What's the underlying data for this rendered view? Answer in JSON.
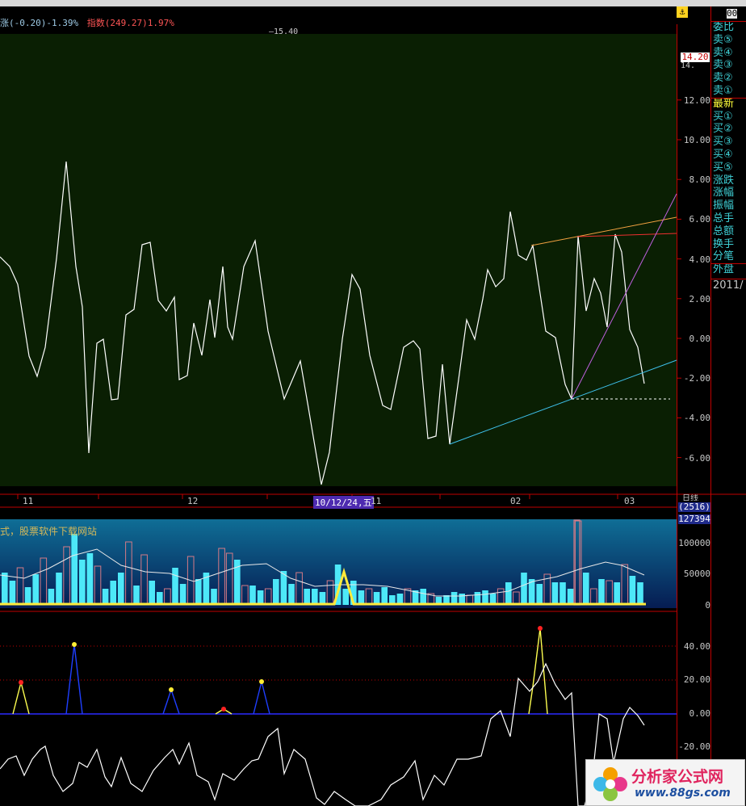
{
  "header": {
    "change_prefix": "涨",
    "change_value": "(-0.20)-1.39%",
    "index_label": "指数",
    "index_value": "(249.27)1.97%",
    "max_marker": "—15.40"
  },
  "top_bar": {
    "code_fragment": "00",
    "bell_icon": "bell-icon"
  },
  "price_badge": "14.20",
  "price_badge_suffix": "14.",
  "side_panel": {
    "items": [
      "委比",
      "卖⑤",
      "卖④",
      "卖③",
      "卖②",
      "卖①",
      "最新",
      "买①",
      "买②",
      "买③",
      "买④",
      "买⑤",
      "涨跌",
      "涨幅",
      "振幅",
      "总手",
      "总额",
      "换手",
      "分笔",
      "外盘"
    ],
    "highlight": "最新",
    "date": "2011/"
  },
  "y_axis_main": [
    "12.00",
    "10.00",
    "8.00",
    "6.00",
    "4.00",
    "2.00",
    "0.00",
    "-2.00",
    "-4.00",
    "-6.00"
  ],
  "x_axis": {
    "ticks": [
      "11",
      "12",
      "11",
      "02",
      "03"
    ],
    "cursor_label": "10/12/24,五",
    "period": "日线"
  },
  "volume_panel": {
    "title": "式，股票软件下载网站",
    "count": "(2516)",
    "value": "127394",
    "y_axis": [
      "100000",
      "50000",
      "0"
    ]
  },
  "indicator_panel": {
    "y_axis": [
      "40.00",
      "20.00",
      "0.00",
      "-20.00"
    ]
  },
  "logo": {
    "text": "分析家公式网",
    "url": "www.88gs.com"
  },
  "colors": {
    "main_bg": "#0a1f03",
    "line": "#ffffff",
    "axis": "#c00000",
    "side_text": "#3fd0d6",
    "highlight": "#ffff3a",
    "bar_cyan": "#4de8f8",
    "bar_outline": "#d57a86"
  }
}
